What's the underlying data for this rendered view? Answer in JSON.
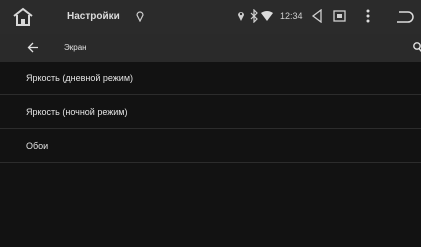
{
  "statusbar": {
    "title": "Настройки",
    "time": "12:34",
    "icons": [
      "home-icon",
      "location-icon",
      "bluetooth-icon",
      "wifi-icon",
      "back-nav-icon",
      "recent-apps-icon",
      "menu-dots-icon",
      "return-icon"
    ]
  },
  "toolbar": {
    "title": "Экран",
    "icons": [
      "arrow-back-icon",
      "search-icon"
    ]
  },
  "settings": {
    "items": [
      {
        "label": "Яркость (дневной режим)"
      },
      {
        "label": "Яркость (ночной режим)"
      },
      {
        "label": "Обои"
      }
    ]
  },
  "colors": {
    "background": "#121212",
    "statusbar": "#2b2b2b",
    "toolbar": "#2a2a2a",
    "text": "#e4e4e4",
    "divider": "#2c2c2c"
  }
}
